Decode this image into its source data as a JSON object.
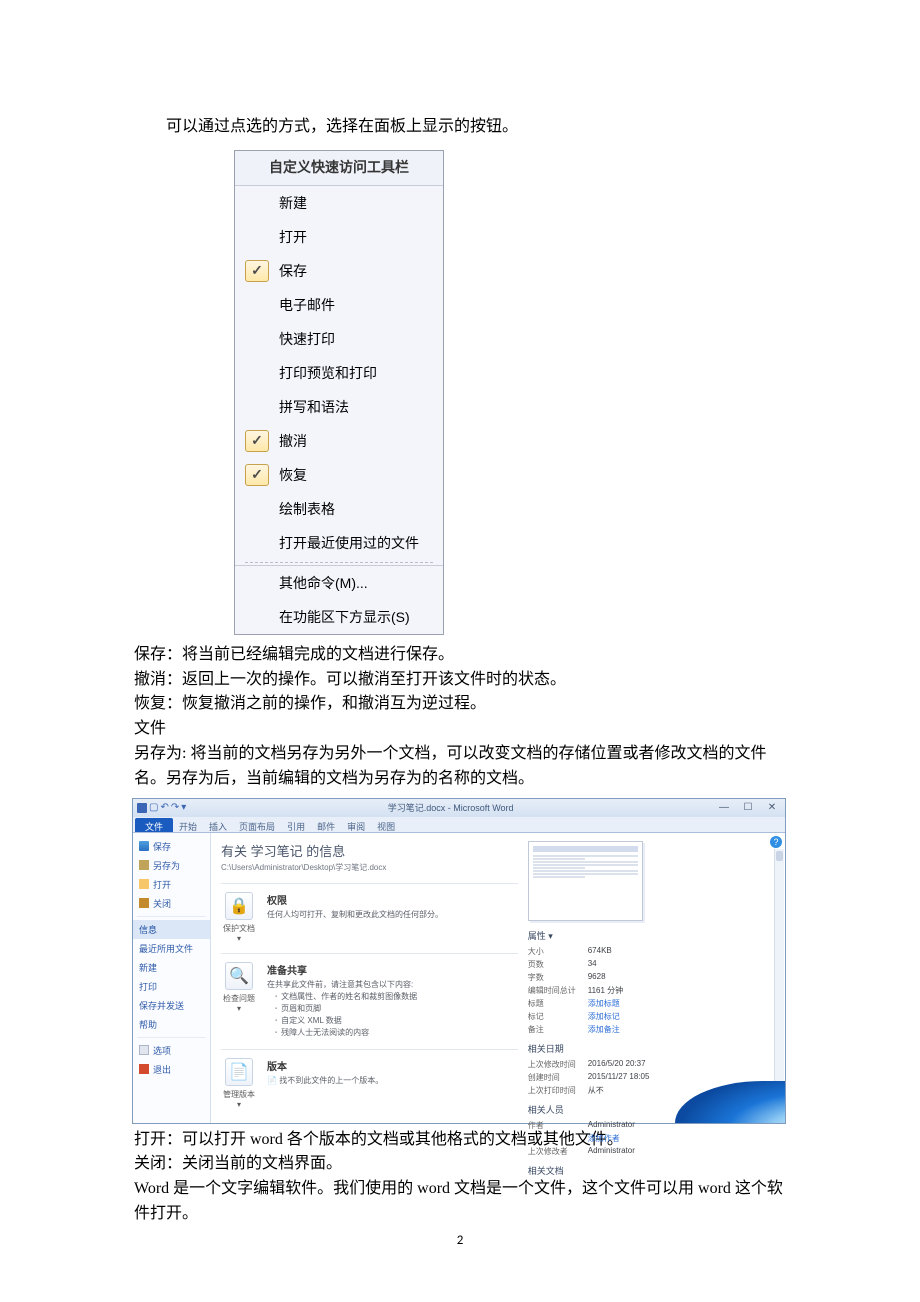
{
  "intro_line": "可以通过点选的方式，选择在面板上显示的按钮。",
  "qat": {
    "title": "自定义快速访问工具栏",
    "items": [
      {
        "label": "新建",
        "checked": false
      },
      {
        "label": "打开",
        "checked": false
      },
      {
        "label": "保存",
        "checked": true
      },
      {
        "label": "电子邮件",
        "checked": false
      },
      {
        "label": "快速打印",
        "checked": false
      },
      {
        "label": "打印预览和打印",
        "checked": false
      },
      {
        "label": "拼写和语法",
        "checked": false
      },
      {
        "label": "撤消",
        "checked": true
      },
      {
        "label": "恢复",
        "checked": true
      },
      {
        "label": "绘制表格",
        "checked": false
      },
      {
        "label": "打开最近使用过的文件",
        "checked": false
      }
    ],
    "more_label": "其他命令(M)...",
    "below_label": "在功能区下方显示(S)"
  },
  "explain": {
    "save": "保存：将当前已经编辑完成的文档进行保存。",
    "undo": "撤消：返回上一次的操作。可以撤消至打开该文件时的状态。",
    "redo": "恢复：恢复撤消之前的操作，和撤消互为逆过程。",
    "file": "文件",
    "saveas": "另存为: 将当前的文档另存为另外一个文档，可以改变文档的存储位置或者修改文档的文件名。另存为后，当前编辑的文档为另存为的名称的文档。"
  },
  "word": {
    "doc_title": "学习笔记.docx - Microsoft Word",
    "tabs": [
      "文件",
      "开始",
      "插入",
      "页面布局",
      "引用",
      "邮件",
      "审阅",
      "视图"
    ],
    "nav": {
      "save": "保存",
      "saveas": "另存为",
      "open": "打开",
      "close": "关闭",
      "info": "信息",
      "recent": "最近所用文件",
      "new": "新建",
      "print": "打印",
      "share": "保存并发送",
      "help": "帮助",
      "options": "选项",
      "exit": "退出"
    },
    "info": {
      "heading": "有关 学习笔记 的信息",
      "path": "C:\\Users\\Administrator\\Desktop\\学习笔记.docx",
      "protect": {
        "badge": "保护文档",
        "title": "权限",
        "desc": "任何人均可打开、复制和更改此文档的任何部分。"
      },
      "prepare": {
        "badge": "检查问题",
        "title": "准备共享",
        "desc": "在共享此文件前，请注意其包含以下内容:",
        "items": [
          "文档属性、作者的姓名和裁剪图像数据",
          "页眉和页脚",
          "自定义 XML 数据",
          "残障人士无法阅读的内容"
        ]
      },
      "versions": {
        "badge": "管理版本",
        "title": "版本",
        "desc": "找不到此文件的上一个版本。"
      }
    },
    "props": {
      "section_label": "属性 ▾",
      "rows": [
        {
          "k": "大小",
          "v": "674KB"
        },
        {
          "k": "页数",
          "v": "34"
        },
        {
          "k": "字数",
          "v": "9628"
        },
        {
          "k": "编辑时间总计",
          "v": "1161 分钟"
        },
        {
          "k": "标题",
          "v": "添加标题",
          "link": true
        },
        {
          "k": "标记",
          "v": "添加标记",
          "link": true
        },
        {
          "k": "备注",
          "v": "添加备注",
          "link": true
        }
      ],
      "dates_label": "相关日期",
      "dates": [
        {
          "k": "上次修改时间",
          "v": "2016/5/20 20:37"
        },
        {
          "k": "创建时间",
          "v": "2015/11/27 18:05"
        },
        {
          "k": "上次打印时间",
          "v": "从不"
        }
      ],
      "people_label": "相关人员",
      "people": [
        {
          "k": "作者",
          "v": "Administrator"
        },
        {
          "k": "",
          "v": "添加作者",
          "link": true
        },
        {
          "k": "上次修改者",
          "v": "Administrator"
        }
      ],
      "docs_label": "相关文档"
    }
  },
  "post": {
    "open": "打开：可以打开 word 各个版本的文档或其他格式的文档或其他文件。",
    "close": "关闭：关闭当前的文档界面。",
    "note": "Word 是一个文字编辑软件。我们使用的 word 文档是一个文件，这个文件可以用 word 这个软件打开。"
  },
  "page_number": "2"
}
